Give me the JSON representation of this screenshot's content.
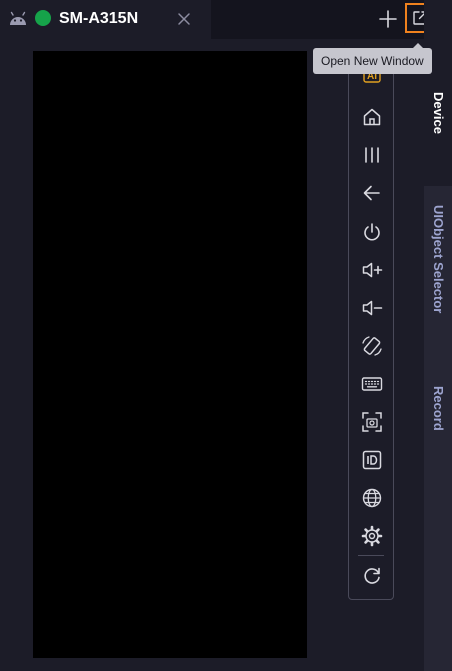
{
  "tab": {
    "device_name": "SM-A315N",
    "status_color": "#16a34a"
  },
  "tooltip": {
    "text": "Open New Window"
  },
  "toolbar": {
    "items": [
      "ai-icon",
      "home-icon",
      "recent-apps-icon",
      "back-icon",
      "power-icon",
      "volume-up-icon",
      "volume-down-icon",
      "rotate-icon",
      "keyboard-icon",
      "screenshot-icon",
      "id-icon",
      "globe-icon",
      "gear-icon",
      "refresh-icon"
    ],
    "ai_label": "AI"
  },
  "side_tabs": {
    "device": "Device",
    "uiobject": "UIObject Selector",
    "record": "Record"
  },
  "colors": {
    "accent": "#f0821e",
    "icon": "#d9d9e0",
    "ai": "#e0a020",
    "inactive_tab": "#9da4cf"
  }
}
